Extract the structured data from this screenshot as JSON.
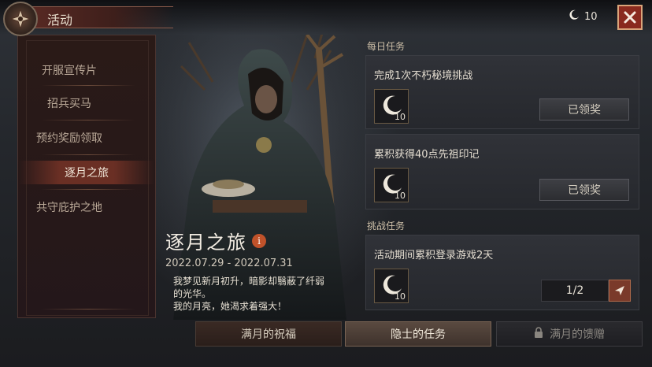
{
  "header": {
    "title": "活动",
    "currency_amount": "10"
  },
  "side_menu": {
    "items": [
      {
        "label": "开服宣传片",
        "active": false
      },
      {
        "label": "招兵买马",
        "active": false
      },
      {
        "label": "预约奖励领取",
        "active": false
      },
      {
        "label": "逐月之旅",
        "active": true
      },
      {
        "label": "共守庇护之地",
        "active": false
      }
    ]
  },
  "event": {
    "title": "逐月之旅",
    "info_glyph": "i",
    "date_range": "2022.07.29 - 2022.07.31",
    "description_line1": "我梦见新月初升，暗影却翳蔽了纤弱",
    "description_line2": "的光华。",
    "description_line3": "我的月亮，她渴求着强大！"
  },
  "daily_tasks": {
    "label": "每日任务",
    "tasks": [
      {
        "name": "完成1次不朽秘境挑战",
        "reward_icon": "crescent-moon-icon",
        "reward_count": "10",
        "button": "已领奖"
      },
      {
        "name": "累积获得40点先祖印记",
        "reward_icon": "crescent-moon-icon",
        "reward_count": "10",
        "button": "已领奖"
      }
    ]
  },
  "challenge_tasks": {
    "label": "挑战任务",
    "tasks": [
      {
        "name": "活动期间累积登录游戏2天",
        "reward_icon": "crescent-moon-icon",
        "reward_count": "10",
        "progress": "1/2"
      }
    ]
  },
  "bottom_tabs": [
    {
      "label": "满月的祝福",
      "selected": false,
      "locked": false
    },
    {
      "label": "隐士的任务",
      "selected": true,
      "locked": false
    },
    {
      "label": "满月的馈赠",
      "selected": false,
      "locked": true
    }
  ],
  "colors": {
    "accent_red": "#8a2a1e",
    "active_menu": "#6a2f24",
    "panel": "#2c2e33"
  }
}
